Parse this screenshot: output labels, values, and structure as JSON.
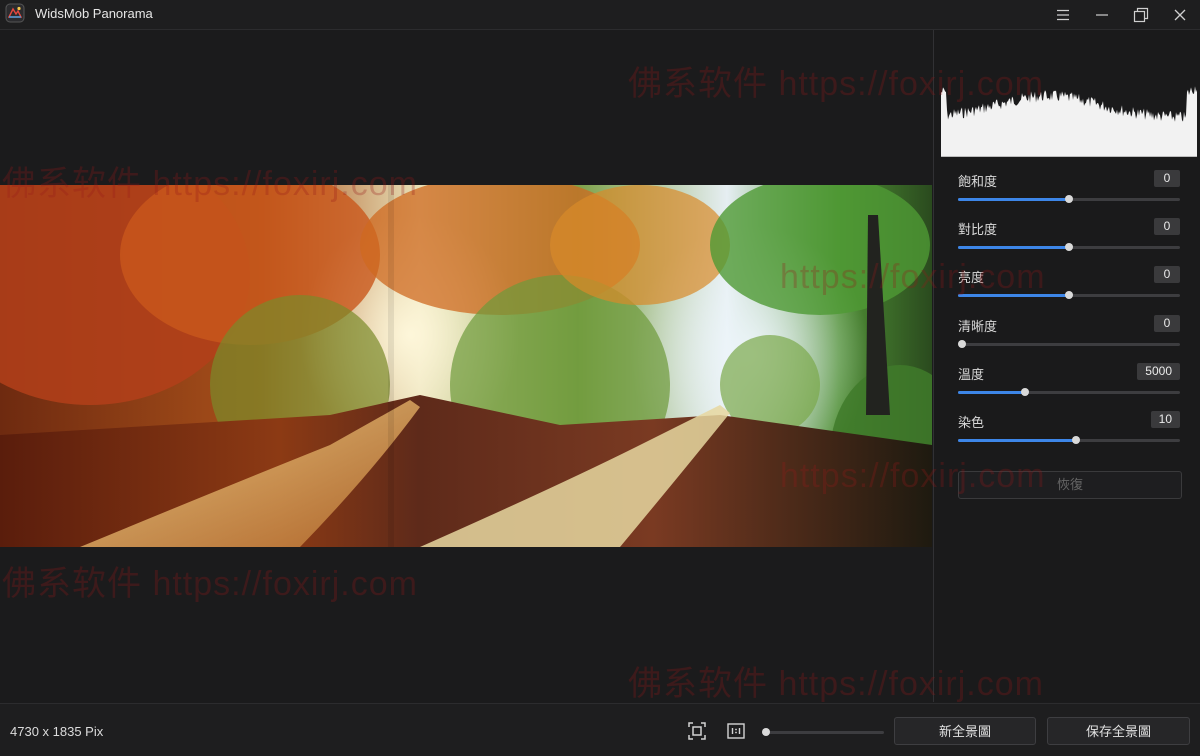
{
  "app": {
    "title": "WidsMob Panorama"
  },
  "window_controls": {
    "menu_icon": "menu-icon",
    "minimize_icon": "minimize-icon",
    "restore_icon": "restore-icon",
    "close_icon": "close-icon"
  },
  "adjustments": [
    {
      "label": "飽和度",
      "value": "0",
      "level": 0.5
    },
    {
      "label": "對比度",
      "value": "0",
      "level": 0.5
    },
    {
      "label": "亮度",
      "value": "0",
      "level": 0.5
    },
    {
      "label": "清晰度",
      "value": "0",
      "level": 0.0
    },
    {
      "label": "溫度",
      "value": "5000",
      "level": 0.3
    },
    {
      "label": "染色",
      "value": "10",
      "level": 0.53
    }
  ],
  "reset_label": "恢復",
  "status": {
    "dimensions": "4730 x 1835 Pix"
  },
  "toolbar": {
    "fit_icon": "fit-screen-icon",
    "actual_size_icon": "actual-size-icon",
    "zoom_level": 0.0,
    "new_panorama_label": "新全景圖",
    "save_panorama_label": "保存全景圖"
  },
  "watermarks": [
    "佛系软件 https://foxirj.com",
    "佛系软件 https://foxirj.com",
    "佛系软件 https://foxirj.com",
    "佛系软件 https://foxirj.com",
    "https://foxirj.com",
    "https://foxirj.com"
  ],
  "colors": {
    "accent": "#3d86e8",
    "background": "#1b1b1c",
    "watermark": "#961919"
  }
}
